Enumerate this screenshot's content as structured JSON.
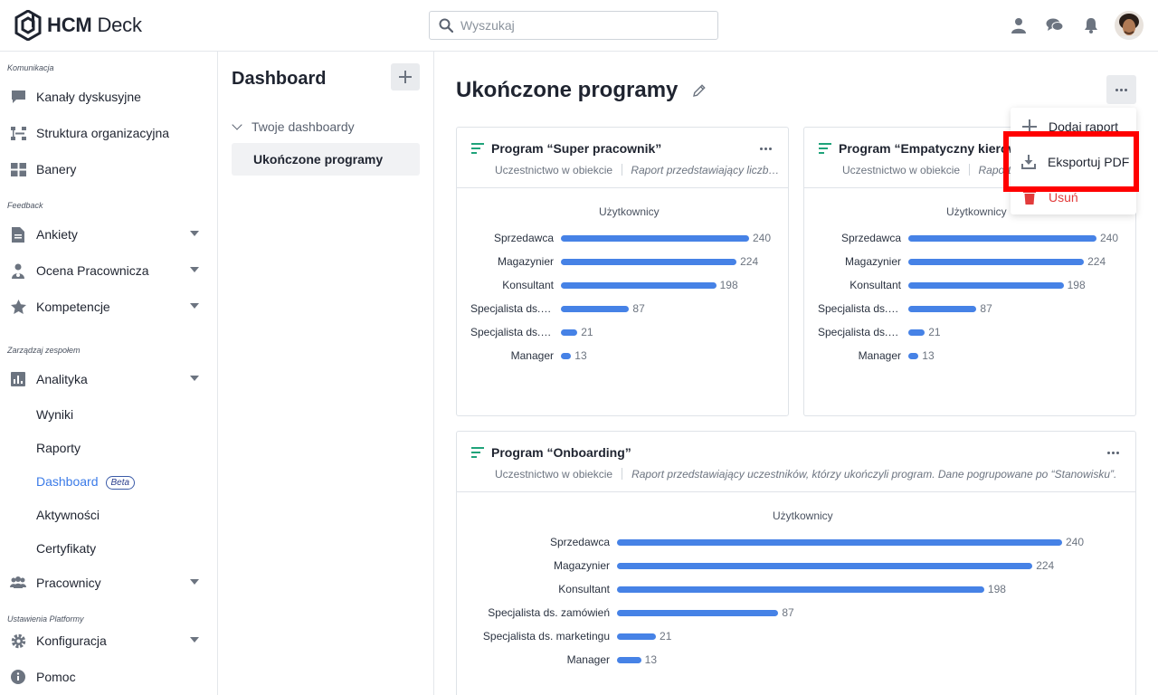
{
  "app": {
    "logo_bold": "HCM",
    "logo_light": "Deck"
  },
  "search": {
    "placeholder": "Wyszukaj"
  },
  "sidebar": {
    "sections": [
      {
        "title": "Komunikacja"
      },
      {
        "title": "Feedback"
      },
      {
        "title": "Zarządzaj zespołem"
      },
      {
        "title": "Ustawienia Platformy"
      }
    ],
    "items": [
      {
        "label": "Kanały dyskusyjne",
        "icon": "chat-icon"
      },
      {
        "label": "Struktura organizacyjna",
        "icon": "org-structure-icon"
      },
      {
        "label": "Banery",
        "icon": "banner-icon"
      },
      {
        "label": "Ankiety",
        "icon": "document-icon"
      },
      {
        "label": "Ocena Pracownicza",
        "icon": "user-rating-icon"
      },
      {
        "label": "Kompetencje",
        "icon": "star-icon"
      },
      {
        "label": "Analityka",
        "icon": "chart-icon"
      },
      {
        "label": "Pracownicy",
        "icon": "people-icon"
      },
      {
        "label": "Konfiguracja",
        "icon": "gear-icon"
      },
      {
        "label": "Pomoc",
        "icon": "info-icon"
      }
    ],
    "analytics_sub": [
      {
        "label": "Wyniki"
      },
      {
        "label": "Raporty"
      },
      {
        "label": "Dashboard",
        "badge": "Beta"
      },
      {
        "label": "Aktywności"
      },
      {
        "label": "Certyfikaty"
      }
    ]
  },
  "dashboards": {
    "title": "Dashboard",
    "group": "Twoje dashboardy",
    "items": [
      {
        "label": "Ukończone programy"
      }
    ]
  },
  "main": {
    "title": "Ukończone programy"
  },
  "menu": {
    "items": [
      {
        "label": "Dodaj raport"
      },
      {
        "label": "Eksportuj PDF"
      },
      {
        "label": "Usuń"
      }
    ]
  },
  "cards": [
    {
      "title": "Program “Super pracownik”",
      "subtitle": "Uczestnictwo w obiekcie",
      "description": "Raport przedstawiający liczbę uczestników, którzy ukończyli program. Dane pogrupowane po “Stanowisku”."
    },
    {
      "title": "Program “Empatyczny kierownik”",
      "subtitle": "Uczestnictwo w obiekcie",
      "description": "Raport przedstawiający liczbę uczestników, którzy ukończyli program."
    },
    {
      "title": "Program “Onboarding”",
      "subtitle": "Uczestnictwo w obiekcie",
      "description": "Raport przedstawiający uczestników, którzy ukończyli program. Dane pogrupowane po “Stanowisku”."
    }
  ],
  "chart_data": [
    {
      "type": "bar",
      "title": "Użytkownicy",
      "categories": [
        "Sprzedawca",
        "Magazynier",
        "Konsultant",
        "Specjalista ds. zamówień",
        "Specjalista ds. marketingu",
        "Manager"
      ],
      "values": [
        240,
        224,
        198,
        87,
        21,
        13
      ],
      "orientation": "horizontal",
      "data_labels": true
    },
    {
      "type": "bar",
      "title": "Użytkownicy",
      "categories": [
        "Sprzedawca",
        "Magazynier",
        "Konsultant",
        "Specjalista ds. zamówień",
        "Specjalista ds. marketingu",
        "Manager"
      ],
      "values": [
        240,
        224,
        198,
        87,
        21,
        13
      ],
      "orientation": "horizontal",
      "data_labels": true
    },
    {
      "type": "bar",
      "title": "Użytkownicy",
      "categories": [
        "Sprzedawca",
        "Magazynier",
        "Konsultant",
        "Specjalista ds. zamówień",
        "Specjalista ds. marketingu",
        "Manager"
      ],
      "values": [
        240,
        224,
        198,
        87,
        21,
        13
      ],
      "orientation": "horizontal",
      "data_labels": true
    }
  ],
  "colors": {
    "accent": "#3b7be8",
    "bar": "#4682e6",
    "danger": "#e23b3b",
    "card_icon": "#1fa37a",
    "highlight": "#ff0000"
  }
}
